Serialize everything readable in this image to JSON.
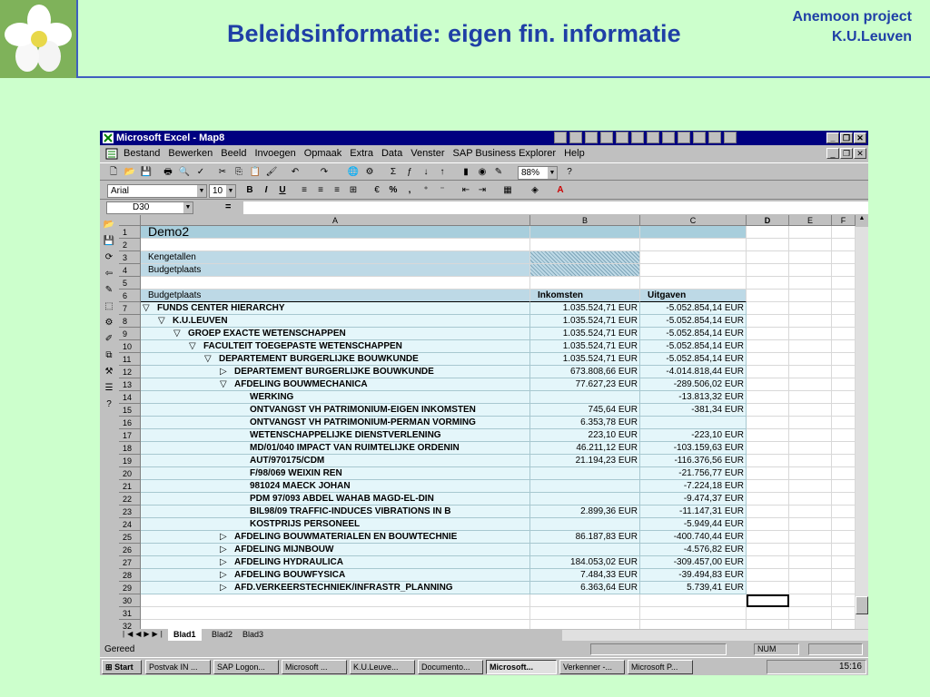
{
  "slide": {
    "title": "Beleidsinformatie: eigen fin. informatie",
    "project_line1": "Anemoon project",
    "project_line2": "K.U.Leuven"
  },
  "window": {
    "title": "Microsoft Excel - Map8",
    "minimize": "_",
    "restore": "❐",
    "close": "✕"
  },
  "menu": [
    "Bestand",
    "Bewerken",
    "Beeld",
    "Invoegen",
    "Opmaak",
    "Extra",
    "Data",
    "Venster",
    "SAP Business Explorer",
    "Help"
  ],
  "toolbar": {
    "zoom": "88%",
    "font": "Arial",
    "font_size": "10"
  },
  "formula": {
    "namebox": "D30",
    "equals": "="
  },
  "columns": [
    "A",
    "B",
    "C",
    "D",
    "E",
    "F"
  ],
  "rows": [
    {
      "n": "1",
      "a": "Demo2",
      "b": "",
      "c": "",
      "style": "title"
    },
    {
      "n": "2",
      "a": "",
      "b": "",
      "c": "",
      "style": "blank"
    },
    {
      "n": "3",
      "a": "Kengetallen",
      "b": "",
      "c": "",
      "style": "hatch"
    },
    {
      "n": "4",
      "a": "Budgetplaats",
      "b": "",
      "c": "",
      "style": "hatch"
    },
    {
      "n": "5",
      "a": "",
      "b": "",
      "c": "",
      "style": "blank"
    },
    {
      "n": "6",
      "a": "Budgetplaats",
      "b": "Inkomsten",
      "c": "Uitgaven",
      "style": "header"
    },
    {
      "n": "7",
      "indent": 0,
      "tri": "▽",
      "a": "FUNDS CENTER HIERARCHY",
      "b": "1.035.524,71  EUR",
      "c": "-5.052.854,14  EUR"
    },
    {
      "n": "8",
      "indent": 1,
      "tri": "▽",
      "a": "K.U.LEUVEN",
      "b": "1.035.524,71  EUR",
      "c": "-5.052.854,14  EUR"
    },
    {
      "n": "9",
      "indent": 2,
      "tri": "▽",
      "a": "GROEP EXACTE WETENSCHAPPEN",
      "b": "1.035.524,71  EUR",
      "c": "-5.052.854,14  EUR"
    },
    {
      "n": "10",
      "indent": 3,
      "tri": "▽",
      "a": "FACULTEIT TOEGEPASTE WETENSCHAPPEN",
      "b": "1.035.524,71  EUR",
      "c": "-5.052.854,14  EUR"
    },
    {
      "n": "11",
      "indent": 4,
      "tri": "▽",
      "a": "DEPARTEMENT BURGERLIJKE BOUWKUNDE",
      "b": "1.035.524,71  EUR",
      "c": "-5.052.854,14  EUR"
    },
    {
      "n": "12",
      "indent": 5,
      "tri": "▷",
      "a": "DEPARTEMENT BURGERLIJKE BOUWKUNDE",
      "b": "673.808,66  EUR",
      "c": "-4.014.818,44  EUR"
    },
    {
      "n": "13",
      "indent": 5,
      "tri": "▽",
      "a": "AFDELING BOUWMECHANICA",
      "b": "77.627,23  EUR",
      "c": "-289.506,02  EUR"
    },
    {
      "n": "14",
      "indent": 6,
      "tri": "",
      "a": "WERKING",
      "b": "",
      "c": "-13.813,32  EUR"
    },
    {
      "n": "15",
      "indent": 6,
      "tri": "",
      "a": "ONTVANGST VH PATRIMONIUM-EIGEN INKOMSTEN",
      "b": "745,64  EUR",
      "c": "-381,34  EUR"
    },
    {
      "n": "16",
      "indent": 6,
      "tri": "",
      "a": "ONTVANGST VH PATRIMONIUM-PERMAN VORMING",
      "b": "6.353,78  EUR",
      "c": ""
    },
    {
      "n": "17",
      "indent": 6,
      "tri": "",
      "a": "WETENSCHAPPELIJKE DIENSTVERLENING",
      "b": "223,10  EUR",
      "c": "-223,10  EUR"
    },
    {
      "n": "18",
      "indent": 6,
      "tri": "",
      "a": "MD/01/040 IMPACT VAN RUIMTELIJKE ORDENIN",
      "b": "46.211,12  EUR",
      "c": "-103.159,63  EUR"
    },
    {
      "n": "19",
      "indent": 6,
      "tri": "",
      "a": "AUT/970175/CDM",
      "b": "21.194,23  EUR",
      "c": "-116.376,56  EUR"
    },
    {
      "n": "20",
      "indent": 6,
      "tri": "",
      "a": "F/98/069 WEIXIN REN",
      "b": "",
      "c": "-21.756,77  EUR"
    },
    {
      "n": "21",
      "indent": 6,
      "tri": "",
      "a": "981024 MAECK JOHAN",
      "b": "",
      "c": "-7.224,18  EUR"
    },
    {
      "n": "22",
      "indent": 6,
      "tri": "",
      "a": "PDM 97/093 ABDEL WAHAB MAGD-EL-DIN",
      "b": "",
      "c": "-9.474,37  EUR"
    },
    {
      "n": "23",
      "indent": 6,
      "tri": "",
      "a": "BIL98/09 TRAFFIC-INDUCES VIBRATIONS IN B",
      "b": "2.899,36  EUR",
      "c": "-11.147,31  EUR"
    },
    {
      "n": "24",
      "indent": 6,
      "tri": "",
      "a": "KOSTPRIJS PERSONEEL",
      "b": "",
      "c": "-5.949,44  EUR"
    },
    {
      "n": "25",
      "indent": 5,
      "tri": "▷",
      "a": "AFDELING BOUWMATERIALEN EN BOUWTECHNIE",
      "b": "86.187,83  EUR",
      "c": "-400.740,44  EUR"
    },
    {
      "n": "26",
      "indent": 5,
      "tri": "▷",
      "a": "AFDELING MIJNBOUW",
      "b": "",
      "c": "-4.576,82  EUR"
    },
    {
      "n": "27",
      "indent": 5,
      "tri": "▷",
      "a": "AFDELING HYDRAULICA",
      "b": "184.053,02  EUR",
      "c": "-309.457,00  EUR"
    },
    {
      "n": "28",
      "indent": 5,
      "tri": "▷",
      "a": "AFDELING BOUWFYSICA",
      "b": "7.484,33  EUR",
      "c": "-39.494,83  EUR"
    },
    {
      "n": "29",
      "indent": 5,
      "tri": "▷",
      "a": "AFD.VERKEERSTECHNIEK/INFRASTR_PLANNING",
      "b": "6.363,64  EUR",
      "c": "5.739,41  EUR"
    },
    {
      "n": "30",
      "a": "",
      "b": "",
      "c": "",
      "style": "blank"
    },
    {
      "n": "31",
      "a": "",
      "b": "",
      "c": "",
      "style": "blank"
    },
    {
      "n": "32",
      "a": "",
      "b": "",
      "c": "",
      "style": "blank"
    }
  ],
  "tabs": [
    "Blad1",
    "Blad2",
    "Blad3"
  ],
  "status": {
    "text": "Gereed",
    "num": "NUM"
  },
  "taskbar": {
    "start": "Start",
    "items": [
      "Postvak IN ...",
      "SAP Logon...",
      "Microsoft ...",
      "K.U.Leuve...",
      "Documento...",
      "Microsoft...",
      "Verkenner -...",
      "Microsoft P..."
    ],
    "clock": "15:16"
  }
}
